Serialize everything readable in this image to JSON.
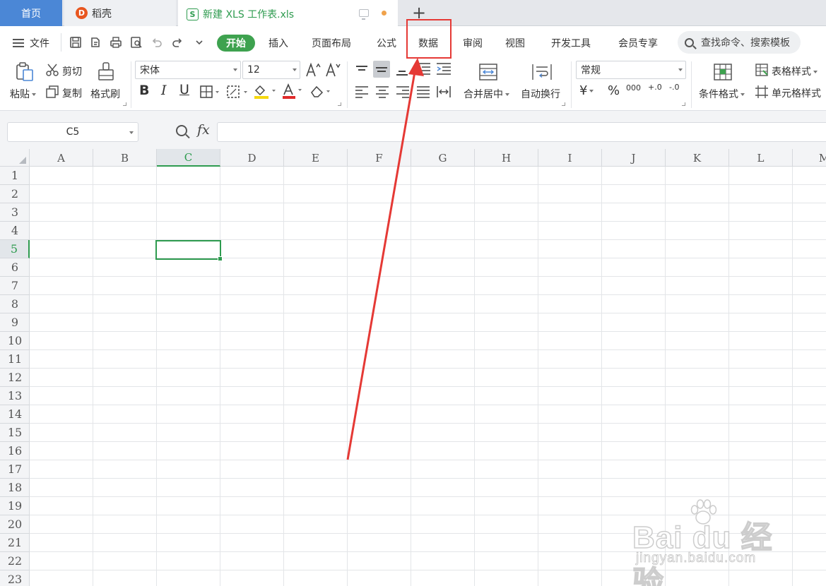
{
  "tabs": {
    "home": "首页",
    "docer": "稻壳",
    "docer_logo": "D",
    "file": "新建 XLS 工作表.xls",
    "file_logo": "S",
    "add": "+"
  },
  "menu": {
    "file": "文件",
    "items": [
      "开始",
      "插入",
      "页面布局",
      "公式",
      "数据",
      "审阅",
      "视图",
      "开发工具",
      "会员专享"
    ],
    "highlighted": "数据",
    "search_placeholder": "查找命令、搜索模板"
  },
  "ribbon": {
    "paste": "粘贴",
    "cut": "剪切",
    "copy": "复制",
    "format_painter": "格式刷",
    "font_name": "宋体",
    "font_size": "12",
    "bold": "B",
    "italic": "I",
    "underline": "U",
    "merge_center": "合并居中",
    "wrap_text": "自动换行",
    "number_format": "常规",
    "currency": "¥",
    "percent": "%",
    "thousands": "000",
    "inc_decimal": "+.0",
    "dec_decimal": "-.0",
    "conditional_format": "条件格式",
    "table_style": "表格样式",
    "cell_style": "单元格样式"
  },
  "formula_bar": {
    "cell_ref": "C5",
    "fx": "fx",
    "formula": ""
  },
  "grid": {
    "columns": [
      "A",
      "B",
      "C",
      "D",
      "E",
      "F",
      "G",
      "H",
      "I",
      "J",
      "K",
      "L",
      "M"
    ],
    "rows": [
      "1",
      "2",
      "3",
      "4",
      "5",
      "6",
      "7",
      "8",
      "9",
      "10",
      "11",
      "12",
      "13",
      "14",
      "15",
      "16",
      "17",
      "18",
      "19",
      "20",
      "21",
      "22",
      "23"
    ],
    "active_column": "C",
    "active_row": "5"
  },
  "colors": {
    "accent_green": "#2e9b4f",
    "tab_blue": "#4b87d6",
    "annotation_red": "#e53935"
  },
  "watermark": {
    "brand": "Bai du 经验",
    "url": "jingyan.baidu.com"
  }
}
